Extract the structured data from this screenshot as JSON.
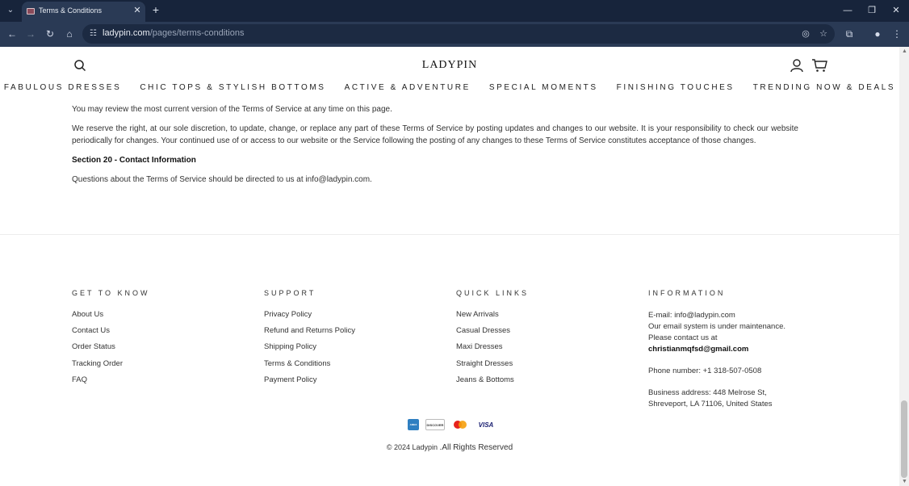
{
  "browser": {
    "tab_title": "Terms & Conditions",
    "url_domain": "ladypin.com",
    "url_path": "/pages/terms-conditions"
  },
  "site": {
    "logo": "LADYPIN",
    "nav": [
      "FABULOUS DRESSES",
      "CHIC TOPS & STYLISH BOTTOMS",
      "ACTIVE & ADVENTURE",
      "SPECIAL MOMENTS",
      "FINISHING TOUCHES",
      "TRENDING NOW & DEALS"
    ]
  },
  "content": {
    "p1": "You may review the most current version of the Terms of Service at any time on this page.",
    "p2": "We reserve the right, at our sole discretion, to update, change, or replace any part of these Terms of Service by posting updates and changes to our website. It is your responsibility to check our website periodically for changes. Your continued use of or access to our website or the Service following the posting of any changes to these Terms of Service constitutes acceptance of those changes.",
    "section_title": "Section 20 - Contact Information",
    "p3": "Questions about the Terms of Service should be directed to us at info@ladypin.com."
  },
  "footer": {
    "get_to_know": {
      "title": "GET TO KNOW",
      "links": [
        "About Us",
        "Contact Us",
        "Order Status",
        "Tracking Order",
        "FAQ"
      ]
    },
    "support": {
      "title": "SUPPORT",
      "links": [
        "Privacy Policy",
        "Refund and Returns Policy",
        "Shipping Policy",
        "Terms & Conditions",
        "Payment Policy"
      ]
    },
    "quick_links": {
      "title": "QUICK LINKS",
      "links": [
        "New Arrivals",
        "Casual Dresses",
        "Maxi Dresses",
        "Straight Dresses",
        "Jeans & Bottoms"
      ]
    },
    "information": {
      "title": "INFORMATION",
      "email_line": "E-mail: info@ladypin.com",
      "maintenance_line": "Our email system is under maintenance. Please contact us at",
      "alt_email": "christianmqfsd@gmail.com",
      "phone": "Phone number: +1 318-507-0508",
      "address": "Business address: 448 Melrose St, Shreveport, LA 71106, United States"
    },
    "payments": {
      "amex": "AMEX",
      "discover": "DISCOVER",
      "visa": "VISA"
    },
    "copyright": "© 2024 Ladypin",
    "rights": ".All Rights Reserved"
  }
}
